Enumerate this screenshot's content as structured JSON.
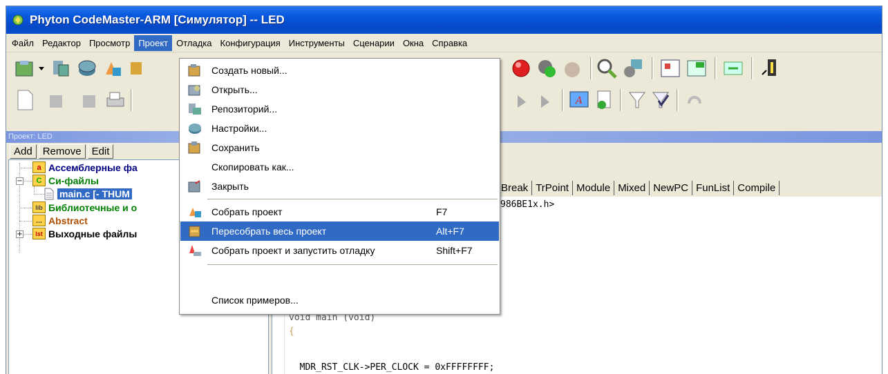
{
  "window": {
    "title": "Phyton CodeMaster-ARM [Симулятор] -- LED"
  },
  "menubar": {
    "items": [
      "Файл",
      "Редактор",
      "Просмотр",
      "Проект",
      "Отладка",
      "Конфигурация",
      "Инструменты",
      "Сценарии",
      "Окна",
      "Справка"
    ],
    "active": "Проект"
  },
  "project_panel": {
    "header": "Проект: LED",
    "buttons": [
      "Add",
      "Remove",
      "Edit"
    ],
    "tree": [
      {
        "icon": "a",
        "label": "Ассемблерные фа",
        "color": "#000080"
      },
      {
        "icon": "C",
        "label": "Си-файлы",
        "color": "#008000"
      },
      {
        "icon": "file",
        "label": "main.c [- THUM",
        "color": "#ffffff",
        "selected": true
      },
      {
        "icon": "lib",
        "label": "Библиотечные и о",
        "color": "#008000"
      },
      {
        "icon": "...",
        "label": "Abstract",
        "color": "#b05000"
      },
      {
        "icon": "lst",
        "label": "Выходные файлы",
        "color": "#000000"
      }
    ]
  },
  "editor": {
    "tabs": [
      "Break",
      "TrPoint",
      "Module",
      "Mixed",
      "NewPC",
      "FunList",
      "Compile"
    ],
    "lines": [
      "986BE1x.h>",
      "void main (void)",
      "{",
      "  MDR_RST_CLK->PER_CLOCK = 0xFFFFFFFF;"
    ]
  },
  "project_menu": {
    "items": [
      {
        "label": "Создать новый...",
        "shortcut": "",
        "icon": "new-project-icon"
      },
      {
        "label": "Открыть...",
        "shortcut": "",
        "icon": "open-project-icon"
      },
      {
        "label": "Репозиторий...",
        "shortcut": "",
        "icon": "repository-icon"
      },
      {
        "label": "Настройки...",
        "shortcut": "",
        "icon": "settings-icon"
      },
      {
        "label": "Сохранить",
        "shortcut": "",
        "icon": "save-icon"
      },
      {
        "label": "Скопировать как...",
        "shortcut": "",
        "icon": ""
      },
      {
        "label": "Закрыть",
        "shortcut": "",
        "icon": "close-project-icon"
      },
      {
        "label": "Собрать проект",
        "shortcut": "F7",
        "icon": "build-icon"
      },
      {
        "label": "Пересобрать весь проект",
        "shortcut": "Alt+F7",
        "icon": "rebuild-icon",
        "highlighted": true
      },
      {
        "label": "Собрать проект и запустить отладку",
        "shortcut": "Shift+F7",
        "icon": "build-debug-icon"
      },
      {
        "label": "Список примеров...",
        "shortcut": "",
        "icon": ""
      }
    ]
  },
  "colors": {
    "titlebar": "#0a5be0",
    "highlight": "#316ac5",
    "menu_bg": "#ece9d8",
    "code_hex": "#0000c0"
  }
}
